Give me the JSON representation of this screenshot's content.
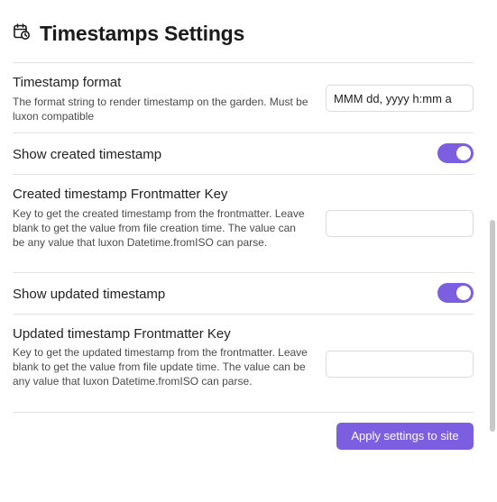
{
  "header": {
    "icon": "calendar-clock-icon",
    "title": "Timestamps Settings"
  },
  "settings": {
    "timestamp_format": {
      "label": "Timestamp format",
      "description": "The format string to render timestamp on the garden. Must be luxon compatible",
      "value": "MMM dd, yyyy h:mm a"
    },
    "show_created": {
      "label": "Show created timestamp",
      "enabled": true
    },
    "created_key": {
      "label": "Created timestamp Frontmatter Key",
      "description": "Key to get the created timestamp from the frontmatter. Leave blank to get the value from file creation time. The value can be any value that luxon Datetime.fromISO can parse.",
      "value": ""
    },
    "show_updated": {
      "label": "Show updated timestamp",
      "enabled": true
    },
    "updated_key": {
      "label": "Updated timestamp Frontmatter Key",
      "description": "Key to get the updated timestamp from the frontmatter. Leave blank to get the value from file update time. The value can be any value that luxon Datetime.fromISO can parse.",
      "value": ""
    }
  },
  "actions": {
    "apply_label": "Apply settings to site"
  },
  "colors": {
    "accent": "#7c5fe0"
  }
}
